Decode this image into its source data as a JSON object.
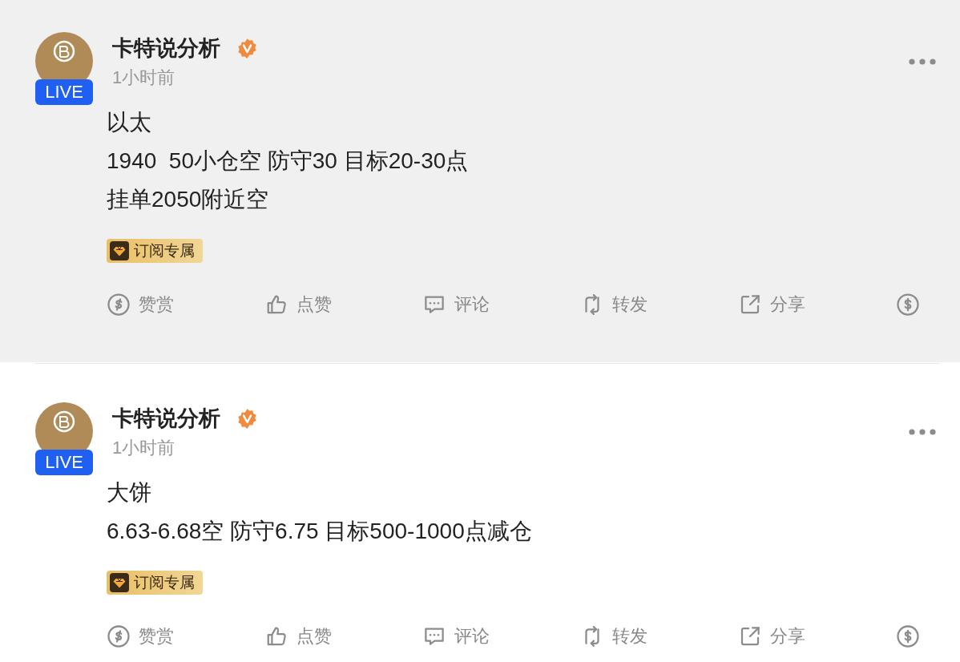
{
  "posts": [
    {
      "highlighted": true,
      "author": "卡特说分析",
      "verified": true,
      "live_badge": "LIVE",
      "time": "1小时前",
      "lines": [
        "以太",
        "1940  50小仓空 防守30 目标20-30点",
        "挂单2050附近空"
      ],
      "tag": "订阅专属",
      "actions": [
        {
          "kind": "reward",
          "label": "赞赏"
        },
        {
          "kind": "like",
          "label": "点赞"
        },
        {
          "kind": "comment",
          "label": "评论"
        },
        {
          "kind": "repost",
          "label": "转发"
        },
        {
          "kind": "share",
          "label": "分享"
        },
        {
          "kind": "tip"
        }
      ]
    },
    {
      "highlighted": false,
      "author": "卡特说分析",
      "verified": true,
      "live_badge": "LIVE",
      "time": "1小时前",
      "lines": [
        "大饼",
        "6.63-6.68空 防守6.75 目标500-1000点减仓"
      ],
      "tag": "订阅专属",
      "actions": [
        {
          "kind": "reward",
          "label": "赞赏"
        },
        {
          "kind": "like",
          "label": "点赞"
        },
        {
          "kind": "comment",
          "label": "评论"
        },
        {
          "kind": "repost",
          "label": "转发"
        },
        {
          "kind": "share",
          "label": "分享"
        },
        {
          "kind": "tip"
        }
      ]
    }
  ]
}
